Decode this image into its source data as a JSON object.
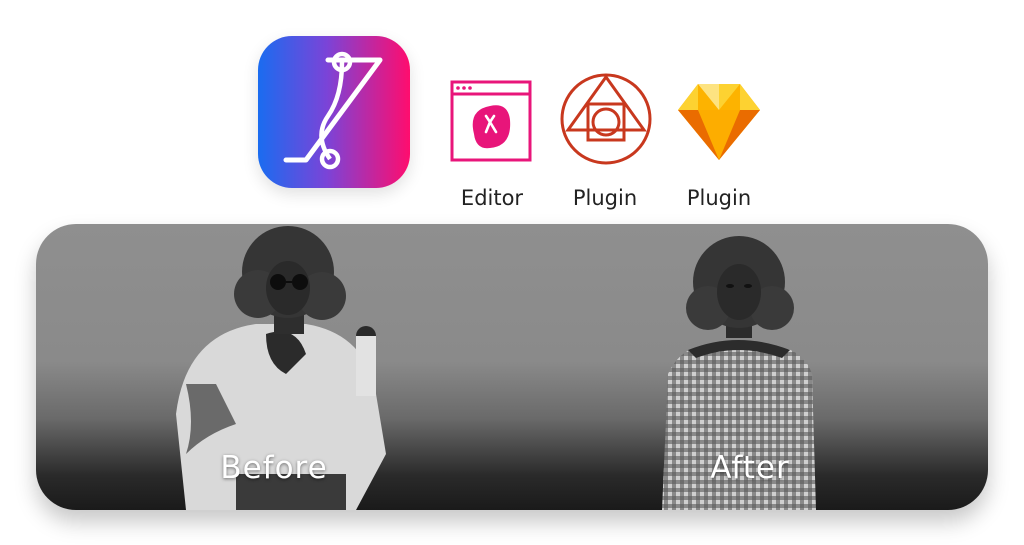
{
  "app": {
    "icon": "bezier-curve-icon",
    "gradient": [
      "#1a6cf0",
      "#ff0d6e"
    ]
  },
  "tools": [
    {
      "label": "Editor",
      "icon": "web-editor-icon",
      "color": "#e8157a"
    },
    {
      "label": "Plugin",
      "icon": "photopea-icon",
      "color": "#c8381e"
    },
    {
      "label": "Plugin",
      "icon": "sketch-icon",
      "color": "#f6a623"
    }
  ],
  "comparison": {
    "before_label": "Before",
    "after_label": "After"
  }
}
